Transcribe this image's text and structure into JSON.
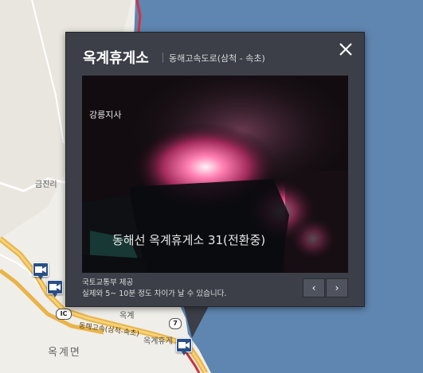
{
  "map": {
    "labels": {
      "geumjin": "금진리",
      "okgye": "옥계면",
      "okgye_rest": "옥계휴게",
      "hwy": "동해고속(삼척-속초)",
      "route7": "7",
      "route_ic": "IC",
      "partial": "옥계"
    },
    "colors": {
      "sea": "#5f86b0",
      "land": "#efeee8",
      "road": "#e9b349",
      "highway_red": "#cc3344"
    }
  },
  "popup": {
    "title": "옥계휴게소",
    "subtitle": "동해고속도로(삼척 - 속초)",
    "close_icon": "close-icon",
    "video": {
      "branch_label": "강릉지사",
      "caption": "동해선 옥계휴게소 31(전환중)"
    },
    "credit_line1": "국토교통부 제공",
    "credit_line2": "실제와 5~ 10분 정도 차이가 날 수 있습니다.",
    "prev_label": "‹",
    "next_label": "›"
  }
}
